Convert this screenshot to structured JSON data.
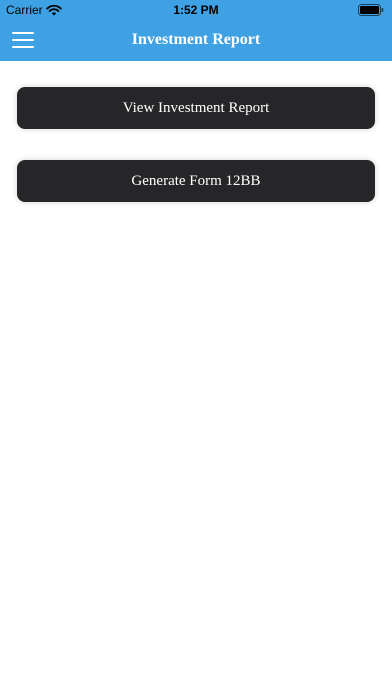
{
  "status_bar": {
    "carrier": "Carrier",
    "time": "1:52 PM",
    "wifi_icon": "wifi-icon",
    "battery_icon": "battery-icon"
  },
  "nav": {
    "title": "Investment Report",
    "menu_icon": "hamburger-menu-icon",
    "background_color": "#3ea1e3"
  },
  "actions": {
    "view_report_label": "View Investment Report",
    "generate_form_label": "Generate Form 12BB",
    "button_color": "#262628"
  }
}
